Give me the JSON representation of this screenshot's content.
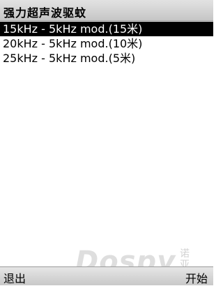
{
  "title": "强力超声波驱蚊",
  "items": [
    {
      "label": "15kHz - 5kHz mod.(15米)",
      "selected": true
    },
    {
      "label": "20kHz - 5kHz mod.(10米)",
      "selected": false
    },
    {
      "label": "25kHz - 5kHz mod.(5米)",
      "selected": false
    }
  ],
  "watermark": {
    "text": "Dospy",
    "subtext": "诺亚"
  },
  "softkeys": {
    "left": "退出",
    "right": "开始"
  }
}
